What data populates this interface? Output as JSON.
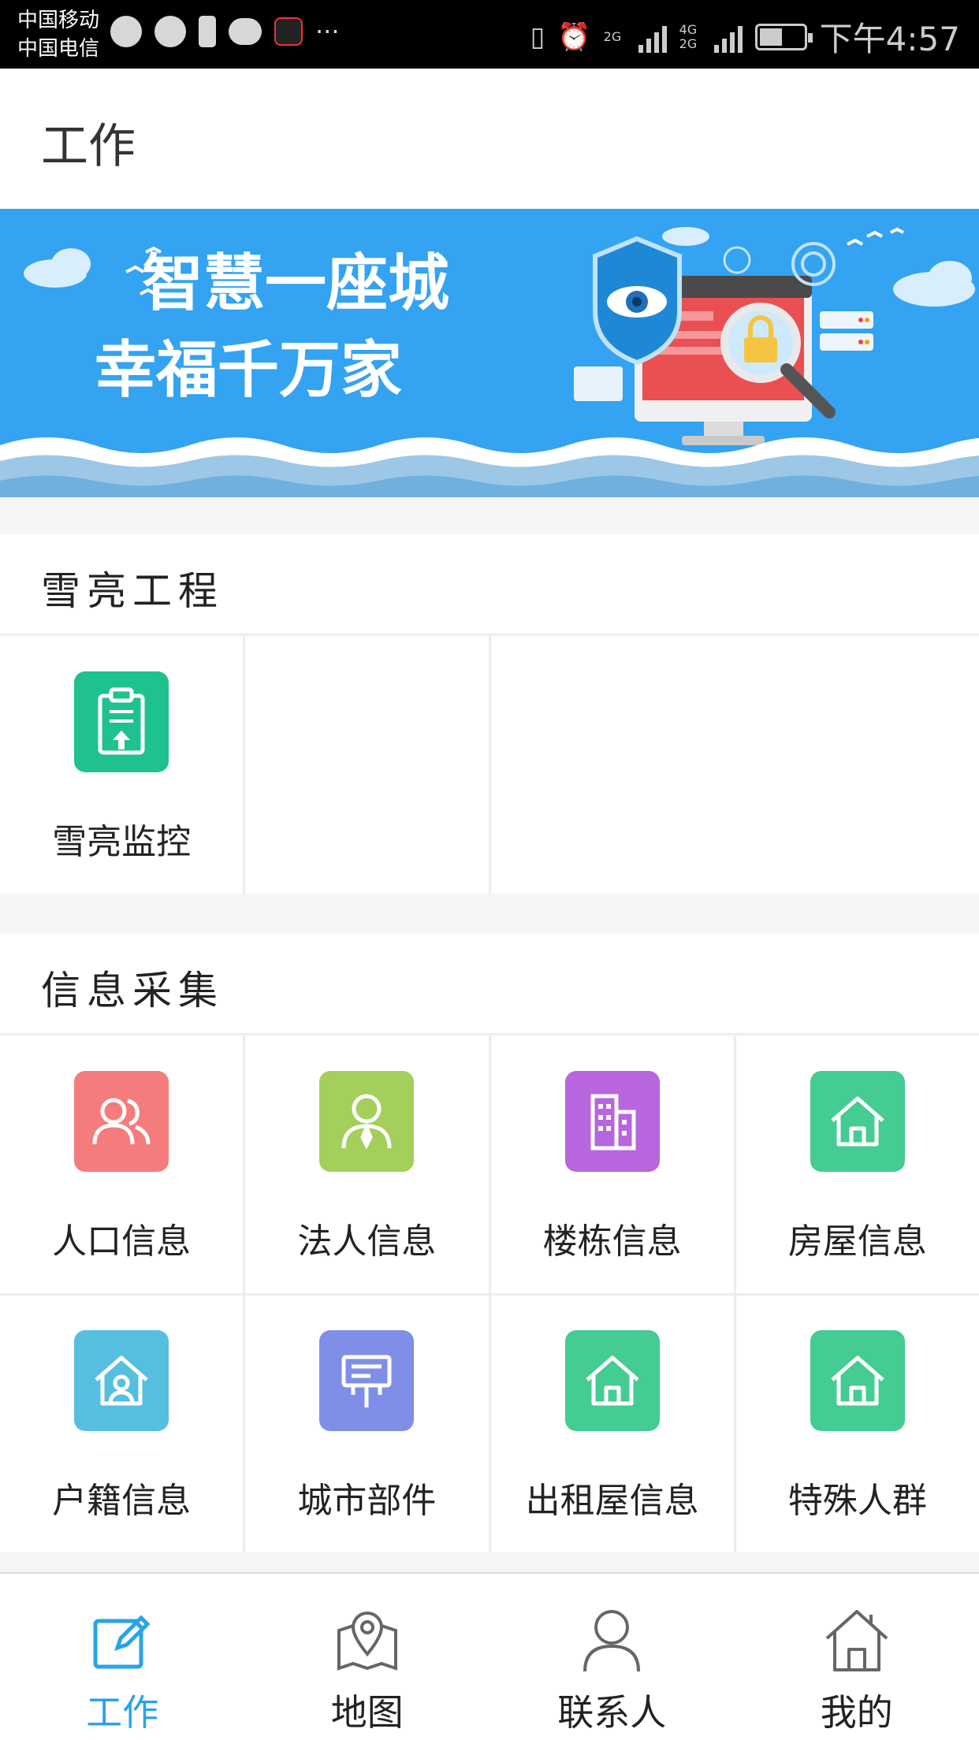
{
  "status_bar": {
    "carrier_1": "中国移动",
    "carrier_2": "中国电信",
    "network_1": "2G",
    "network_2": "4G 2G",
    "time": "下午4:57",
    "more": "···"
  },
  "header": {
    "title": "工作"
  },
  "banner": {
    "line1": "智慧一座城",
    "line2": "幸福千万家"
  },
  "sections": [
    {
      "title": "雪亮工程",
      "items": [
        {
          "label": "雪亮监控",
          "icon": "clipboard-upload-icon",
          "color": "#1fc28e"
        }
      ]
    },
    {
      "title": "信息采集",
      "items": [
        {
          "label": "人口信息",
          "icon": "people-icon",
          "color": "#f57c7c"
        },
        {
          "label": "法人信息",
          "icon": "person-tie-icon",
          "color": "#a4cf5a"
        },
        {
          "label": "楼栋信息",
          "icon": "building-icon",
          "color": "#b766dd"
        },
        {
          "label": "房屋信息",
          "icon": "house-icon",
          "color": "#44cc92"
        },
        {
          "label": "户籍信息",
          "icon": "house-person-icon",
          "color": "#56bfe0"
        },
        {
          "label": "城市部件",
          "icon": "signboard-icon",
          "color": "#7f8fe8"
        },
        {
          "label": "出租屋信息",
          "icon": "house-icon",
          "color": "#44cc92"
        },
        {
          "label": "特殊人群",
          "icon": "house-icon",
          "color": "#44cc92"
        }
      ]
    }
  ],
  "bottom_nav": [
    {
      "label": "工作",
      "icon": "edit-icon",
      "active": true
    },
    {
      "label": "地图",
      "icon": "map-pin-icon",
      "active": false
    },
    {
      "label": "联系人",
      "icon": "contact-icon",
      "active": false
    },
    {
      "label": "我的",
      "icon": "home-icon",
      "active": false
    }
  ],
  "colors": {
    "accent": "#29a3e8",
    "banner_bg": "#33a3f2"
  }
}
